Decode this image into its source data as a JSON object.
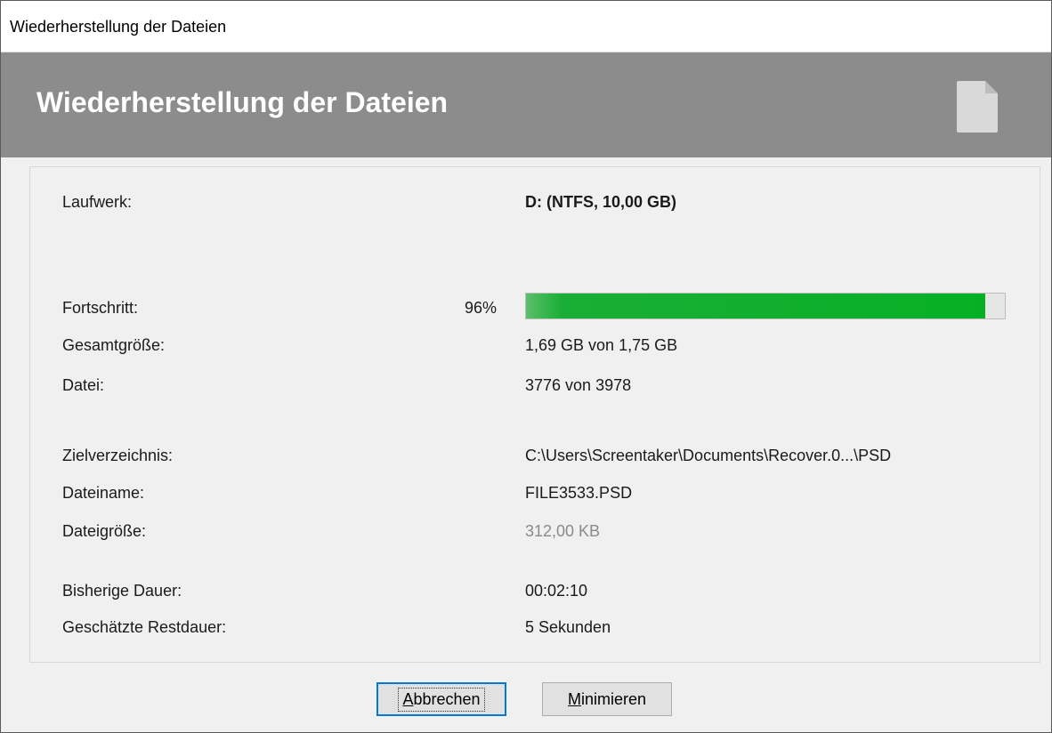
{
  "window": {
    "title": "Wiederherstellung der Dateien"
  },
  "banner": {
    "heading": "Wiederherstellung der Dateien",
    "icon": "document-icon"
  },
  "details": {
    "drive": {
      "label": "Laufwerk:",
      "value": "D: (NTFS, 10,00 GB)"
    },
    "progress": {
      "label": "Fortschritt:",
      "percent_text": "96%",
      "fraction": 0.96
    },
    "total_size": {
      "label": "Gesamtgröße:",
      "value": "1,69 GB von 1,75 GB"
    },
    "file_count": {
      "label": "Datei:",
      "value": "3776 von 3978"
    },
    "target_dir": {
      "label": "Zielverzeichnis:",
      "value": "C:\\Users\\Screentaker\\Documents\\Recover.0...\\PSD"
    },
    "file_name": {
      "label": "Dateiname:",
      "value": "FILE3533.PSD"
    },
    "file_size": {
      "label": "Dateigröße:",
      "value": "312,00 KB"
    },
    "elapsed": {
      "label": "Bisherige Dauer:",
      "value": "00:02:10"
    },
    "remaining": {
      "label": "Geschätzte Restdauer:",
      "value": "5 Sekunden"
    }
  },
  "buttons": {
    "cancel": {
      "label": "Abbrechen",
      "accelerator": "A",
      "rest": "bbrechen"
    },
    "minimize": {
      "label": "Minimieren",
      "accelerator": "M",
      "rest": "inimieren"
    }
  },
  "colors": {
    "banner": "#8c8c8c",
    "progress_fill": "#06b025",
    "focus": "#0078d7"
  }
}
